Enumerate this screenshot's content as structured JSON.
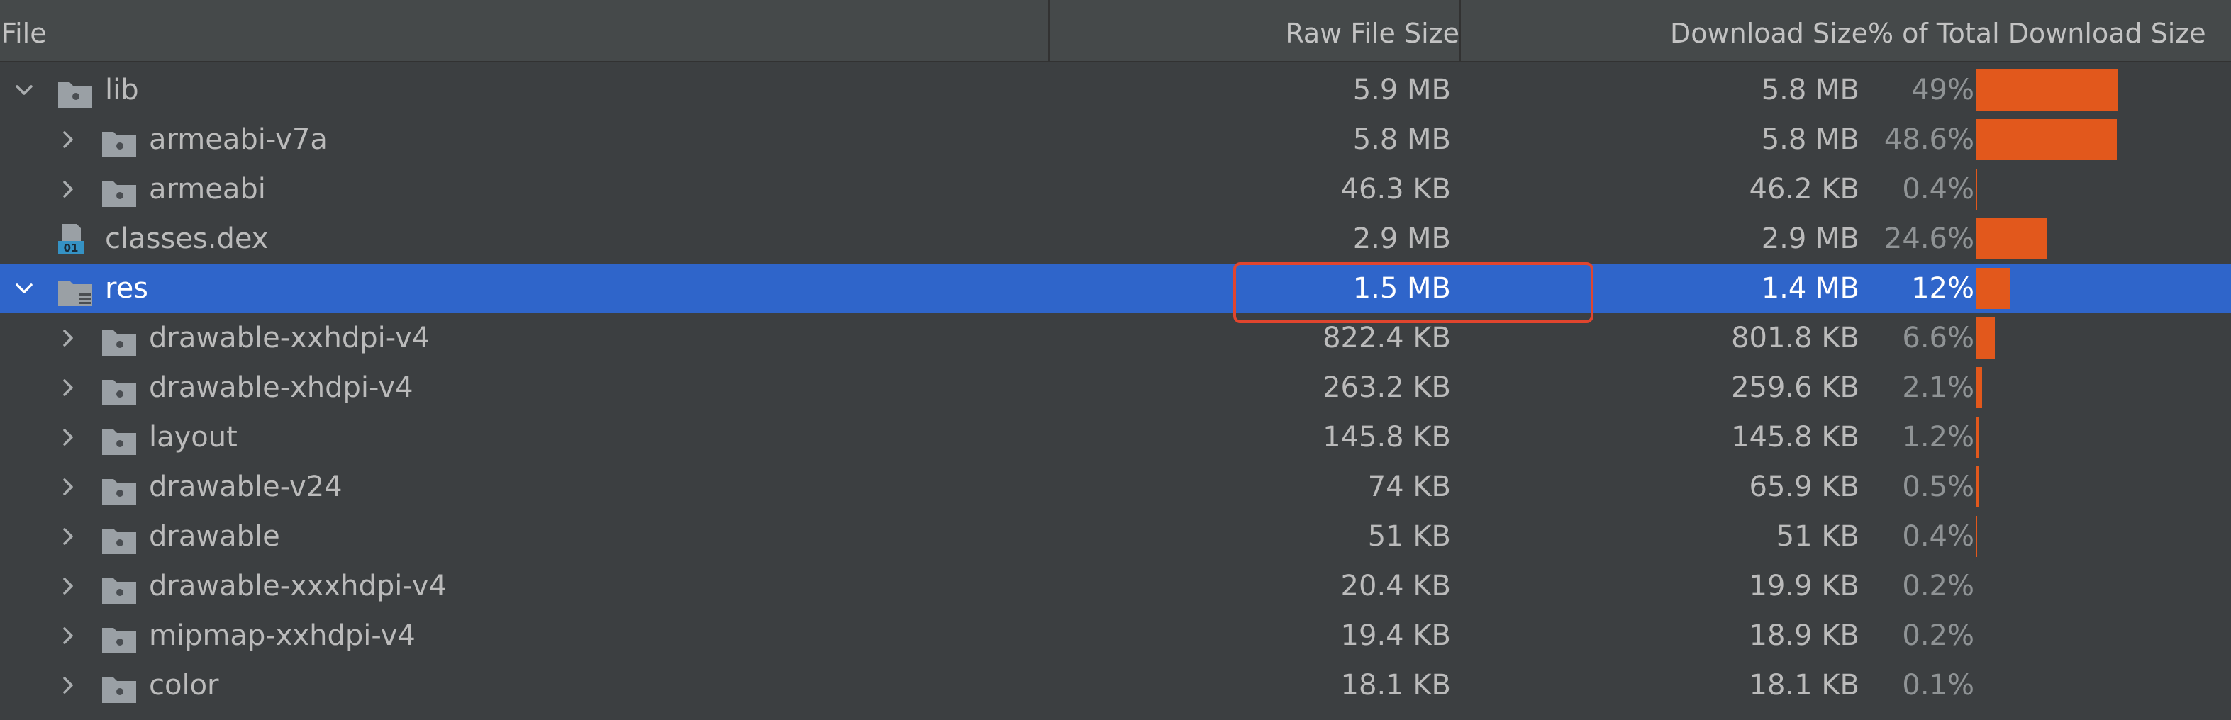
{
  "columns": {
    "file": "File",
    "raw_size": "Raw File Size",
    "download_size": "Download Size",
    "percent": "% of Total Download Size"
  },
  "rows": [
    {
      "name": "lib",
      "type": "folder",
      "expand": "expanded",
      "depth": 0,
      "raw": "5.9 MB",
      "download": "5.8 MB",
      "percent": "49%",
      "fraction": 0.49
    },
    {
      "name": "armeabi-v7a",
      "type": "folder",
      "expand": "collapsed",
      "depth": 1,
      "raw": "5.8 MB",
      "download": "5.8 MB",
      "percent": "48.6%",
      "fraction": 0.486
    },
    {
      "name": "armeabi",
      "type": "folder",
      "expand": "collapsed",
      "depth": 1,
      "raw": "46.3 KB",
      "download": "46.2 KB",
      "percent": "0.4%",
      "fraction": 0.004
    },
    {
      "name": "classes.dex",
      "type": "dex",
      "expand": "none",
      "depth": 0,
      "raw": "2.9 MB",
      "download": "2.9 MB",
      "percent": "24.6%",
      "fraction": 0.246
    },
    {
      "name": "res",
      "type": "res-folder",
      "expand": "expanded",
      "depth": 0,
      "raw": "1.5 MB",
      "download": "1.4 MB",
      "percent": "12%",
      "fraction": 0.12,
      "selected": true
    },
    {
      "name": "drawable-xxhdpi-v4",
      "type": "folder",
      "expand": "collapsed",
      "depth": 1,
      "raw": "822.4 KB",
      "download": "801.8 KB",
      "percent": "6.6%",
      "fraction": 0.066
    },
    {
      "name": "drawable-xhdpi-v4",
      "type": "folder",
      "expand": "collapsed",
      "depth": 1,
      "raw": "263.2 KB",
      "download": "259.6 KB",
      "percent": "2.1%",
      "fraction": 0.021
    },
    {
      "name": "layout",
      "type": "folder",
      "expand": "collapsed",
      "depth": 1,
      "raw": "145.8 KB",
      "download": "145.8 KB",
      "percent": "1.2%",
      "fraction": 0.012
    },
    {
      "name": "drawable-v24",
      "type": "folder",
      "expand": "collapsed",
      "depth": 1,
      "raw": "74 KB",
      "download": "65.9 KB",
      "percent": "0.5%",
      "fraction": 0.005
    },
    {
      "name": "drawable",
      "type": "folder",
      "expand": "collapsed",
      "depth": 1,
      "raw": "51 KB",
      "download": "51 KB",
      "percent": "0.4%",
      "fraction": 0.004
    },
    {
      "name": "drawable-xxxhdpi-v4",
      "type": "folder",
      "expand": "collapsed",
      "depth": 1,
      "raw": "20.4 KB",
      "download": "19.9 KB",
      "percent": "0.2%",
      "fraction": 0.002
    },
    {
      "name": "mipmap-xxhdpi-v4",
      "type": "folder",
      "expand": "collapsed",
      "depth": 1,
      "raw": "19.4 KB",
      "download": "18.9 KB",
      "percent": "0.2%",
      "fraction": 0.002
    },
    {
      "name": "color",
      "type": "folder",
      "expand": "collapsed",
      "depth": 1,
      "raw": "18.1 KB",
      "download": "18.1 KB",
      "percent": "0.1%",
      "fraction": 0.001
    }
  ],
  "colors": {
    "background": "#3c3f41",
    "selection": "#2f65ca",
    "bar": "#e2581c",
    "highlight_box": "#e0452e"
  }
}
